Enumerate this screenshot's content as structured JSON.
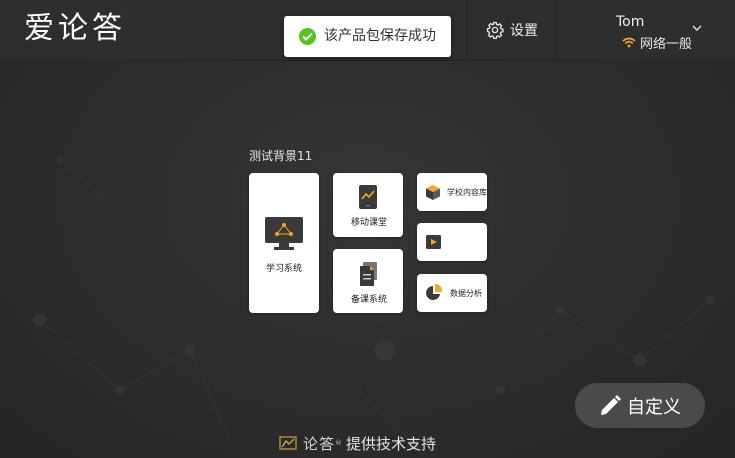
{
  "header": {
    "logo_text": "爱论答",
    "toast_message": "该产品包保存成功",
    "settings_label": "设置",
    "user_name": "Tom",
    "network_status": "网络一般"
  },
  "group": {
    "title": "测试背景11",
    "tiles": [
      {
        "label": "学习系统"
      },
      {
        "label": "移动课堂"
      },
      {
        "label": "备课系统"
      },
      {
        "label": "学校内容库"
      },
      {
        "label": ""
      },
      {
        "label": "数据分析"
      }
    ]
  },
  "custom_button": {
    "label": "自定义"
  },
  "footer": {
    "brand": "论答",
    "text": "提供技术支持"
  },
  "colors": {
    "accent": "#f5a623",
    "success": "#52c41a",
    "background": "#2b2b2b"
  }
}
